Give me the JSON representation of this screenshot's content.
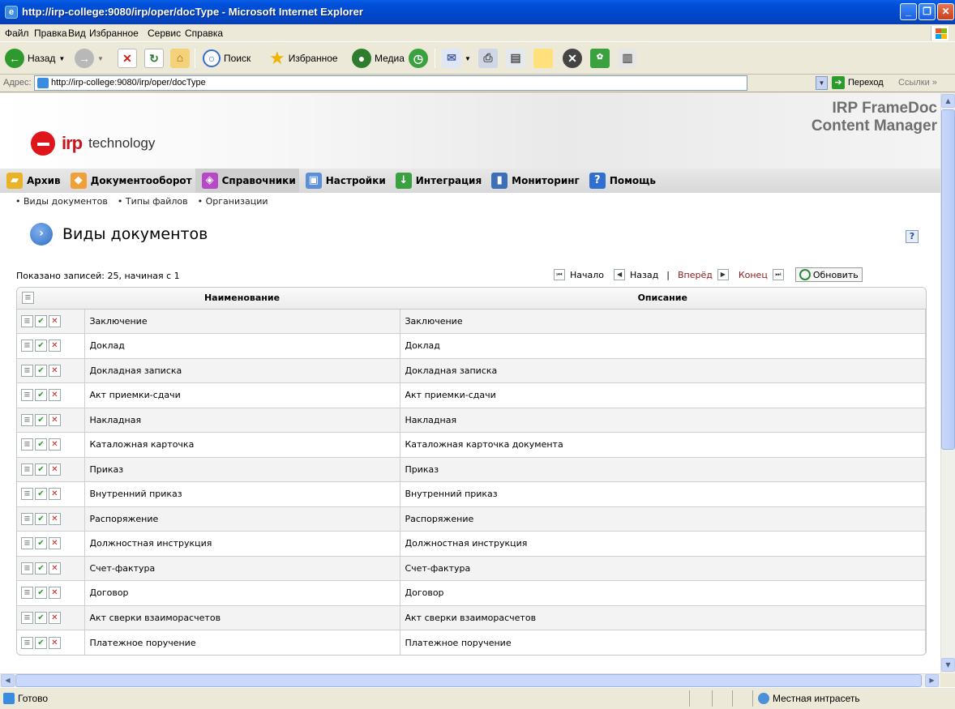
{
  "window": {
    "title": "http://irp-college:9080/irp/oper/docType - Microsoft Internet Explorer"
  },
  "menu": [
    "Файл",
    "Правка",
    "Вид",
    "Избранное",
    "Сервис",
    "Справка"
  ],
  "toolbar": {
    "back": "Назад",
    "search": "Поиск",
    "favorites": "Избранное",
    "media": "Медиа"
  },
  "address": {
    "label": "Адрес:",
    "url": "http://irp-college:9080/irp/oper/docType",
    "go": "Переход",
    "links": "Ссылки"
  },
  "app": {
    "logo_irp": "irp",
    "logo_tech": "technology",
    "product_line1": "IRP FrameDoc",
    "product_line2": "Content Manager"
  },
  "nav": [
    "Архив",
    "Документооборот",
    "Справочники",
    "Настройки",
    "Интеграция",
    "Мониторинг",
    "Помощь"
  ],
  "subnav": [
    "Виды документов",
    "Типы файлов",
    "Организации"
  ],
  "page": {
    "title": "Виды документов",
    "help": "?"
  },
  "pager": {
    "records": "Показано записей: 25, начиная с 1",
    "first": "Начало",
    "prev": "Назад",
    "sep": "|",
    "next": "Вперёд",
    "last": "Конец",
    "refresh": "Обновить"
  },
  "table": {
    "headers": [
      "Наименование",
      "Описание"
    ],
    "rows": [
      [
        "Заключение",
        "Заключение"
      ],
      [
        "Доклад",
        "Доклад"
      ],
      [
        "Докладная записка",
        "Докладная записка"
      ],
      [
        "Акт приемки-сдачи",
        "Акт приемки-сдачи"
      ],
      [
        "Накладная",
        "Накладная"
      ],
      [
        "Каталожная карточка",
        "Каталожная карточка документа"
      ],
      [
        "Приказ",
        "Приказ"
      ],
      [
        "Внутренний приказ",
        "Внутренний приказ"
      ],
      [
        "Распоряжение",
        "Распоряжение"
      ],
      [
        "Должностная инструкция",
        "Должностная инструкция"
      ],
      [
        "Счет-фактура",
        "Счет-фактура"
      ],
      [
        "Договор",
        "Договор"
      ],
      [
        "Акт сверки взаиморасчетов",
        "Акт сверки взаиморасчетов"
      ],
      [
        "Платежное поручение",
        "Платежное поручение"
      ]
    ]
  },
  "status": {
    "ready": "Готово",
    "zone": "Местная интрасеть"
  }
}
